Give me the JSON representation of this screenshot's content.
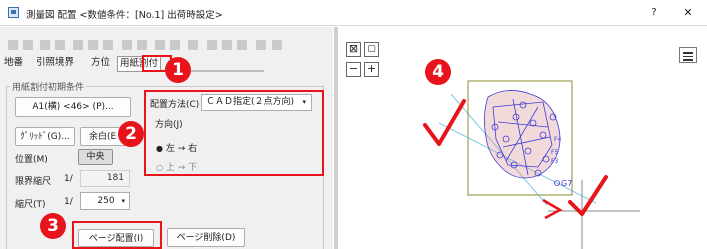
{
  "window": {
    "title": "測量図 配置 <数値条件：[No.1] 出荷時設定>",
    "help": "?",
    "close": "✕"
  },
  "tabs": [
    "地番",
    "引照境界",
    "方位",
    "用紙割付"
  ],
  "group": {
    "label": "用紙割付初期条件",
    "paper_size": "A1(横) <46> (P)...",
    "grid": "ｸﾞﾘｯﾄﾞ(G)...",
    "margin": "余白(E",
    "position_label": "位置(M)",
    "position_value": "中央",
    "limit_label": "限界縮尺",
    "limit_prefix": "1/",
    "limit_value": "181",
    "scale_label": "縮尺(T)",
    "scale_prefix": "1/",
    "scale_value": "250",
    "scale_arrow": "▾"
  },
  "placement": {
    "method_label": "配置方法(C)",
    "method_value": "ＣＡＤ指定(２点方向)",
    "method_arrow": "▾",
    "direction_label": "方向(J)",
    "options": [
      "左 → 右",
      "上 → 下"
    ],
    "selected": 0
  },
  "buttons": {
    "page_place": "ページ配置(I)",
    "page_delete": "ページ削除(D)"
  },
  "badges": [
    "1",
    "2",
    "3",
    "4"
  ],
  "canvas": {
    "point_label": "G7",
    "point_labels": [
      "F5",
      "F4",
      "F3"
    ],
    "zoom_fit": "⊠",
    "zoom_out": "−",
    "zoom_in": "+"
  },
  "colors": {
    "highlight": "#e8131b",
    "drawing": "#3b3bd8",
    "frame": "#8c8c2a",
    "guide": "#7ec8e8"
  }
}
